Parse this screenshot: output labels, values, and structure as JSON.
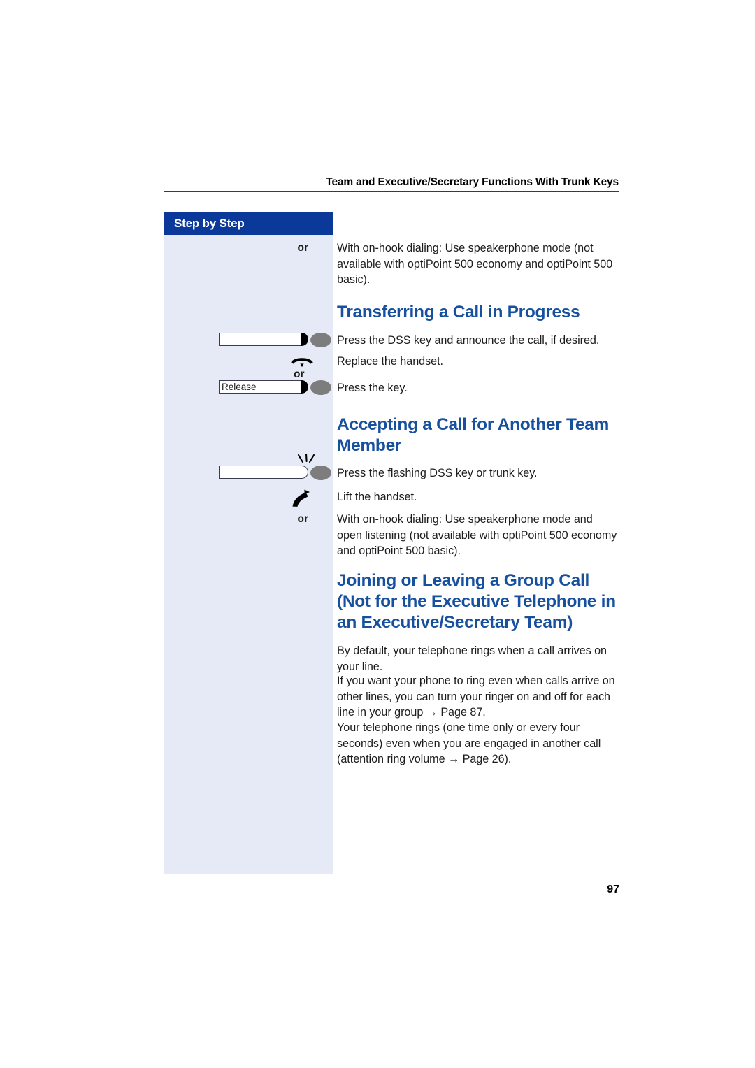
{
  "document": {
    "running_header": "Team and Executive/Secretary Functions With Trunk Keys",
    "page_number": "97",
    "colors": {
      "heading_blue": "#16509e",
      "rail_header_blue": "#0b399a",
      "rail_body_blue": "#e6eaf6",
      "body_text": "#1c1c1c"
    }
  },
  "rail": {
    "title": "Step by Step"
  },
  "intro_step": {
    "or_label": "or",
    "text": "With on-hook dialing: Use speakerphone mode (not available with optiPoint 500 economy and optiPoint 500 basic)."
  },
  "sections": [
    {
      "id": "transferring-a-call-in-progress",
      "title": "Transferring a Call in Progress",
      "steps": [
        {
          "icon": "dss-key-lit-icon",
          "key_label": "",
          "text": "Press the DSS key and announce the call, if desired."
        },
        {
          "icon": "replace-handset-icon",
          "text": "Replace the handset."
        },
        {
          "icon": "release-key-icon",
          "or_label": "or",
          "key_label": "Release",
          "text": "Press the key."
        }
      ]
    },
    {
      "id": "accepting-a-call-for-another-team-member",
      "title": "Accepting a Call for Another Team Member",
      "steps": [
        {
          "icon": "dss-key-flashing-icon",
          "key_label": "",
          "text": "Press the flashing DSS key or trunk key."
        },
        {
          "icon": "lift-handset-icon",
          "text": "Lift the handset."
        },
        {
          "icon": "",
          "or_label": "or",
          "text": "With on-hook dialing: Use speakerphone mode and open listening (not available with optiPoint 500 economy and optiPoint 500 basic)."
        }
      ]
    },
    {
      "id": "joining-or-leaving-a-group-call",
      "title": "Joining or Leaving a Group Call (Not for the Executive Telephone in an Executive/Secretary Team)",
      "paragraphs": [
        "By default, your telephone rings when a call arrives on your line.",
        "If you want your phone to ring even when calls arrive on other lines, you can turn your ringer on and off for each line in your group → Page 87.",
        "Your telephone rings (one time only or every four seconds) even when you are engaged in another call (attention ring volume → Page 26)."
      ]
    }
  ]
}
